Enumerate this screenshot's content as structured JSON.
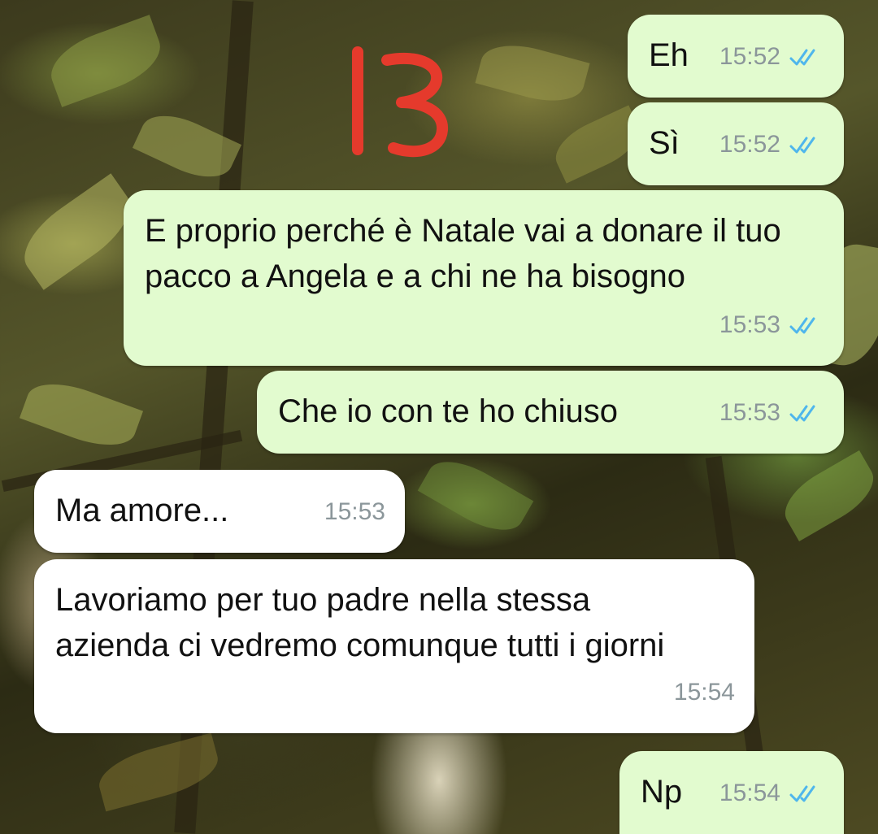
{
  "annotation": {
    "label": "13",
    "color": "#e53a2c"
  },
  "messages": [
    {
      "direction": "outgoing",
      "text": "Eh",
      "time": "15:52",
      "status_icon": "double-check-icon"
    },
    {
      "direction": "outgoing",
      "text": "Sì",
      "time": "15:52",
      "status_icon": "double-check-icon"
    },
    {
      "direction": "outgoing",
      "text": "E proprio perché è Natale vai a donare il tuo pacco a Angela e a chi ne ha bisogno",
      "time": "15:53",
      "status_icon": "double-check-icon"
    },
    {
      "direction": "outgoing",
      "text": "Che io con te ho chiuso",
      "time": "15:53",
      "status_icon": "double-check-icon"
    },
    {
      "direction": "incoming",
      "text": "Ma amore...",
      "time": "15:53"
    },
    {
      "direction": "incoming",
      "text": "Lavoriamo per tuo padre nella stessa azienda ci vedremo comunque tutti i giorni",
      "time": "15:54"
    },
    {
      "direction": "outgoing",
      "text": "Np",
      "time": "15:54",
      "status_icon": "double-check-icon"
    }
  ],
  "colors": {
    "outgoing_bubble": "#e2fbcf",
    "incoming_bubble": "#ffffff",
    "read_ticks": "#4fb6ec",
    "timestamp": "#8b969a"
  }
}
